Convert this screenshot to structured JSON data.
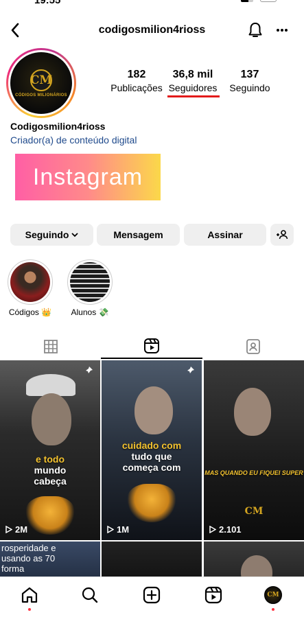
{
  "status_bar": {
    "time": "19:55"
  },
  "header": {
    "username": "codigosmilion4rioss"
  },
  "profile": {
    "avatar_monogram": "CM",
    "avatar_brand": "CÓDIGOS MILIONÁRIOS",
    "stats": [
      {
        "value": "182",
        "label": "Publicações"
      },
      {
        "value": "36,8 mil",
        "label": "Seguidores"
      },
      {
        "value": "137",
        "label": "Seguindo"
      }
    ],
    "display_name": "Codigosmilion4rioss",
    "category": "Criador(a) de conteúdo digital",
    "banner_text": "Instagram"
  },
  "actions": {
    "following": "Seguindo",
    "message": "Mensagem",
    "subscribe": "Assinar"
  },
  "highlights": [
    {
      "label": "Códigos 👑"
    },
    {
      "label": "Alunos 💸"
    }
  ],
  "grid": [
    {
      "caption_yellow": "e todo",
      "caption_white": "mundo cabeça",
      "views": "2M",
      "pinned": true
    },
    {
      "caption_yellow": "cuidado com",
      "caption_white": "tudo que começa com",
      "views": "1M",
      "pinned": true
    },
    {
      "caption_yellow": "MAS QUANDO EU FIQUEI SUPER",
      "caption_white": "",
      "views": "2.101",
      "pinned": false
    }
  ],
  "grid_row2_text": "rosperidade e usando as 70 forma",
  "colors": {
    "accent_link": "#1f4a8c",
    "highlight_underline": "#e31a1a",
    "notification_dot": "#ff3040",
    "gold": "#d4a520"
  },
  "icons": {
    "back": "chevron-left-icon",
    "bell": "bell-icon",
    "more": "more-icon",
    "add_user": "add-user-icon",
    "grid_tab": "grid-icon",
    "reels_tab": "reels-icon",
    "tagged_tab": "tagged-icon",
    "home": "home-icon",
    "search": "search-icon",
    "create": "create-icon",
    "reels_nav": "reels-icon",
    "pin": "pin-icon",
    "play": "play-icon"
  }
}
